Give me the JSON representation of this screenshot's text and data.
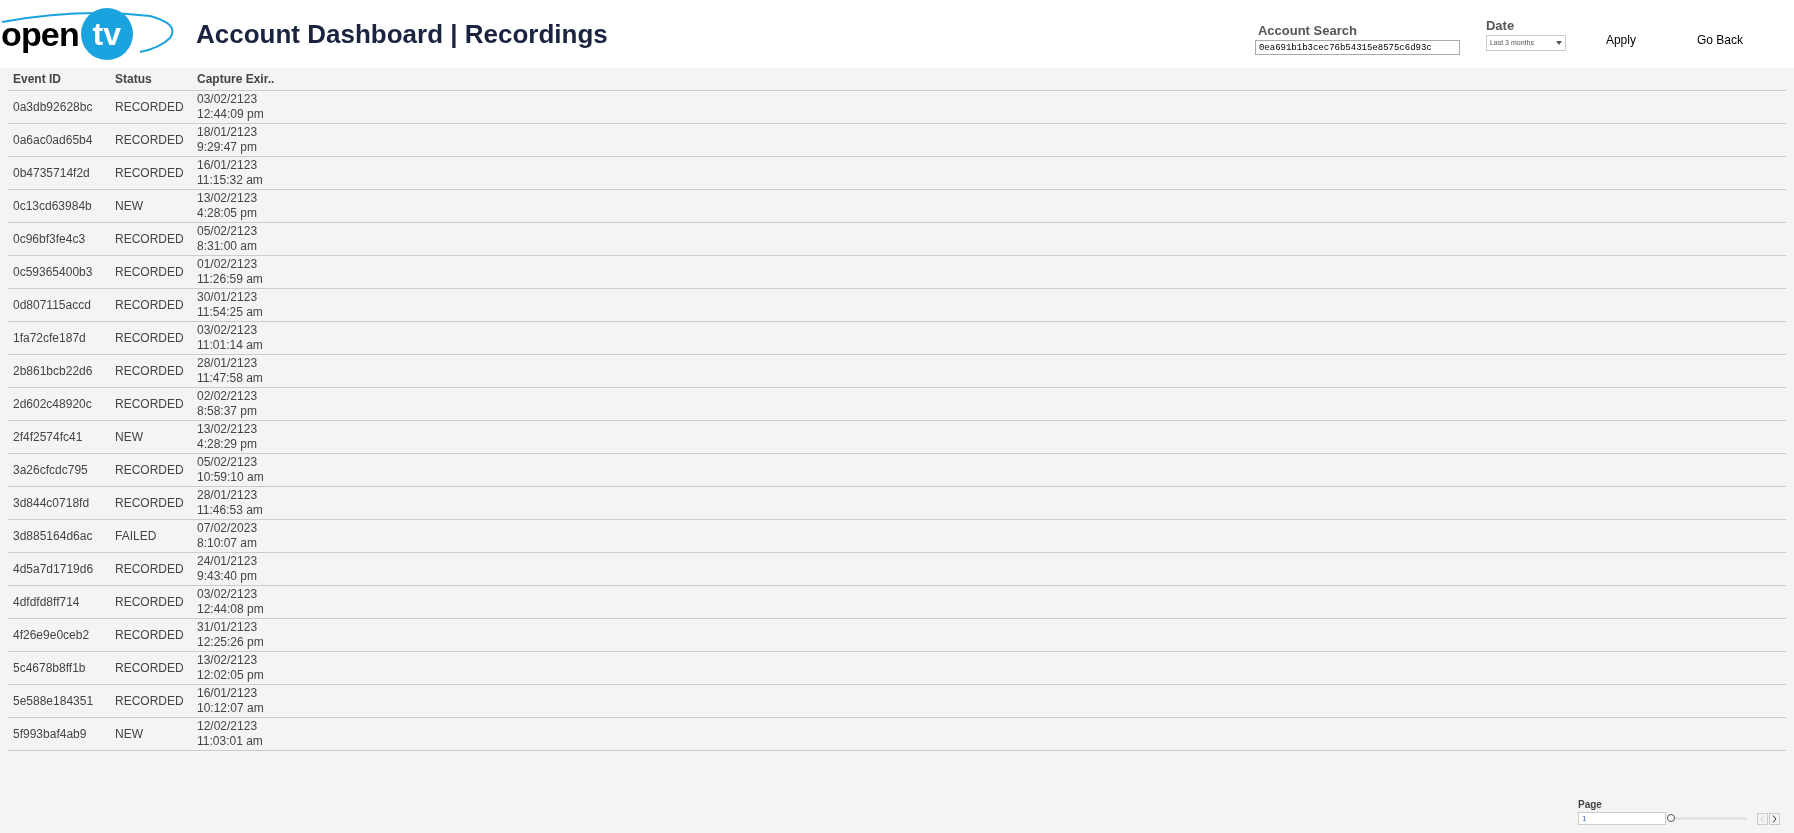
{
  "logo": {
    "text": "open",
    "badge": "tv"
  },
  "title": "Account Dashboard | Recordings",
  "account_search": {
    "label": "Account Search",
    "value": "0ea691b1b3cec76b54315e8575c6d93c"
  },
  "date": {
    "label": "Date",
    "value": "Last 3 months"
  },
  "actions": [
    "Apply",
    "Go Back"
  ],
  "table": {
    "columns": [
      "Event ID",
      "Status",
      "Capture Exir.."
    ],
    "rows": [
      [
        "0a3db92628bc",
        "RECORDED",
        "03/02/2123",
        "12:44:09 pm"
      ],
      [
        "0a6ac0ad65b4",
        "RECORDED",
        "18/01/2123",
        "9:29:47 pm"
      ],
      [
        "0b4735714f2d",
        "RECORDED",
        "16/01/2123",
        "11:15:32 am"
      ],
      [
        "0c13cd63984b",
        "NEW",
        "13/02/2123",
        "4:28:05 pm"
      ],
      [
        "0c96bf3fe4c3",
        "RECORDED",
        "05/02/2123",
        "8:31:00 am"
      ],
      [
        "0c59365400b3",
        "RECORDED",
        "01/02/2123",
        "11:26:59 am"
      ],
      [
        "0d807115accd",
        "RECORDED",
        "30/01/2123",
        "11:54:25 am"
      ],
      [
        "1fa72cfe187d",
        "RECORDED",
        "03/02/2123",
        "11:01:14 am"
      ],
      [
        "2b861bcb22d6",
        "RECORDED",
        "28/01/2123",
        "11:47:58 am"
      ],
      [
        "2d602c48920c",
        "RECORDED",
        "02/02/2123",
        "8:58:37 pm"
      ],
      [
        "2f4f2574fc41",
        "NEW",
        "13/02/2123",
        "4:28:29 pm"
      ],
      [
        "3a26cfcdc795",
        "RECORDED",
        "05/02/2123",
        "10:59:10 am"
      ],
      [
        "3d844c0718fd",
        "RECORDED",
        "28/01/2123",
        "11:46:53 am"
      ],
      [
        "3d885164d6ac",
        "FAILED",
        "07/02/2023",
        "8:10:07 am"
      ],
      [
        "4d5a7d1719d6",
        "RECORDED",
        "24/01/2123",
        "9:43:40 pm"
      ],
      [
        "4dfdfd8ff714",
        "RECORDED",
        "03/02/2123",
        "12:44:08 pm"
      ],
      [
        "4f26e9e0ceb2",
        "RECORDED",
        "31/01/2123",
        "12:25:26 pm"
      ],
      [
        "5c4678b8ff1b",
        "RECORDED",
        "13/02/2123",
        "12:02:05 pm"
      ],
      [
        "5e588e184351",
        "RECORDED",
        "16/01/2123",
        "10:12:07 am"
      ],
      [
        "5f993baf4ab9",
        "NEW",
        "12/02/2123",
        "11:03:01 am"
      ]
    ]
  },
  "pager": {
    "label": "Page",
    "value": "1",
    "level": 0,
    "prev_disabled": true,
    "next_disabled": false
  }
}
